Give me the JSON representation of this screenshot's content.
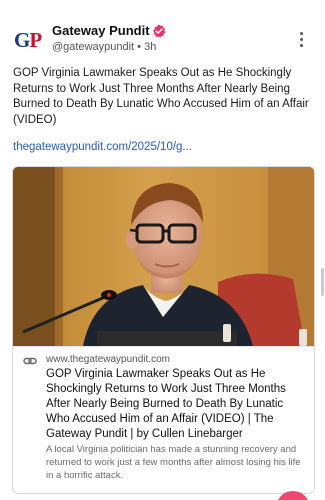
{
  "post": {
    "author": {
      "avatar_text_blue": "G",
      "avatar_text_red": "P",
      "name": "Gateway Pundit",
      "handle": "@gatewaypundit",
      "separator": "•",
      "time": "3h",
      "verified_icon": "verified-badge-icon"
    },
    "text": "GOP Virginia Lawmaker Speaks Out as He Shockingly Returns to Work Just Three Months After Nearly Being Burned to Death By Lunatic Who Accused Him of an Affair (VIDEO)",
    "link_text": "thegatewaypundit.com/2025/10/g...",
    "more_icon": "more-vertical-icon"
  },
  "card": {
    "image_alt": "photo-man-glasses-speaking-microphone",
    "link_icon": "link-icon",
    "domain": "www.thegatewaypundit.com",
    "title": "GOP Virginia Lawmaker Speaks Out as He Shockingly Returns to Work Just Three Months After Nearly Being Burned to Death By Lunatic Who Accused Him of an Affair (VIDEO) | The Gateway Pundit | by Cullen Linebarger",
    "description": "A local Virginia politician has made a stunning recovery and returned to work just a few months after almost losing his life in a horrific attack."
  },
  "colors": {
    "link": "#2b5db5",
    "verified": "#e8336e",
    "fab": "#ef476f"
  }
}
